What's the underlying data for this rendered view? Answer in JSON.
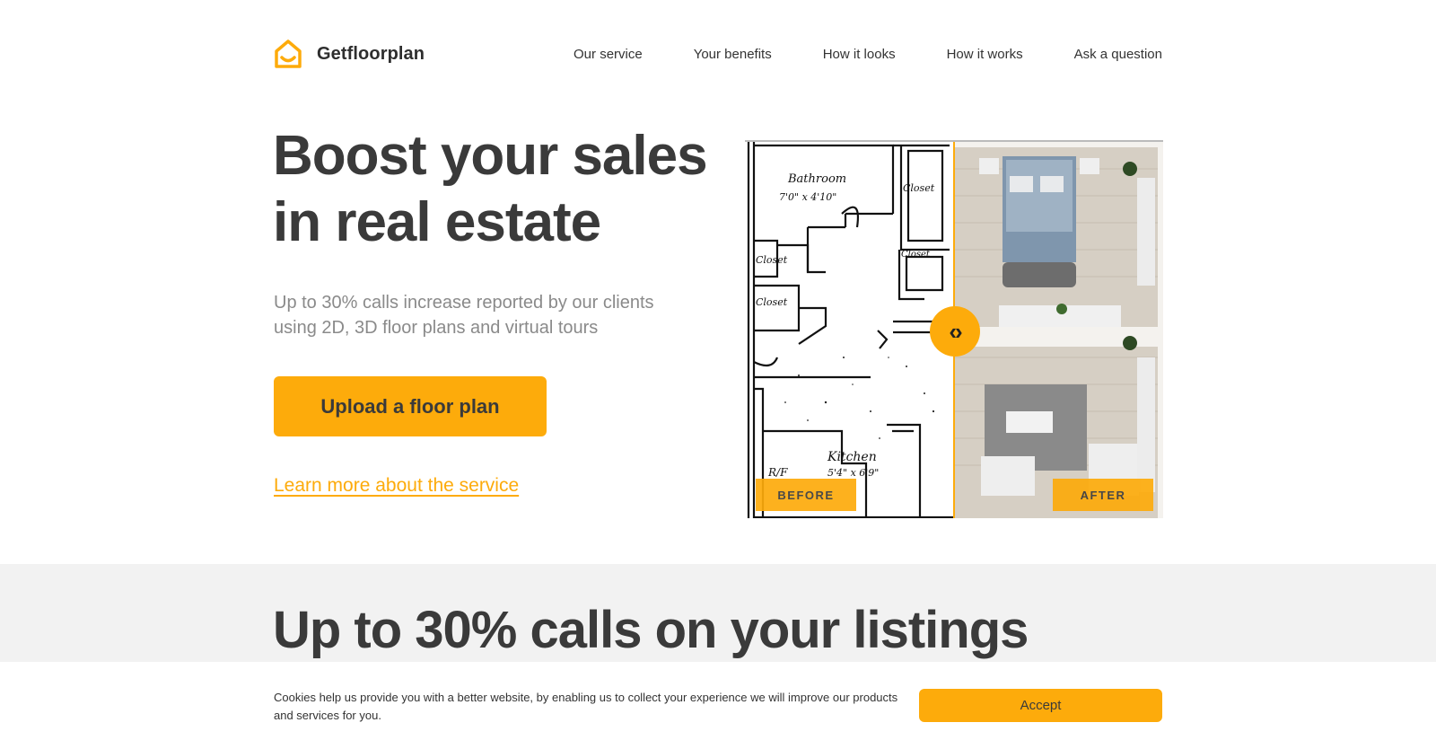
{
  "brand": {
    "name": "Getfloorplan",
    "accent": "#fdab0b"
  },
  "nav": [
    {
      "label": "Our service"
    },
    {
      "label": "Your benefits"
    },
    {
      "label": "How it looks"
    },
    {
      "label": "How it works"
    },
    {
      "label": "Ask a question"
    }
  ],
  "hero": {
    "title": "Boost your sales in real estate",
    "subtitle": "Up to 30% calls increase reported by our clients using 2D, 3D floor plans and virtual tours",
    "cta_label": "Upload a floor plan",
    "learn_more": "Learn more about the service"
  },
  "compare": {
    "before_label": "BEFORE",
    "after_label": "AFTER",
    "sketch_labels": [
      "Bathroom",
      "7'0\" x 4'10\"",
      "Closet",
      "Closet",
      "Closet",
      "Closet",
      "Kitchen",
      "5'4\" x 6'9\"",
      "R/F"
    ],
    "handle_icon": "chevron-left-right-icon"
  },
  "section2": {
    "title": "Up to 30% calls on your listings"
  },
  "cookie": {
    "text": "Cookies help us provide you with a better website, by enabling us to collect your experience we will improve our products and services for you.",
    "accept_label": "Accept"
  }
}
